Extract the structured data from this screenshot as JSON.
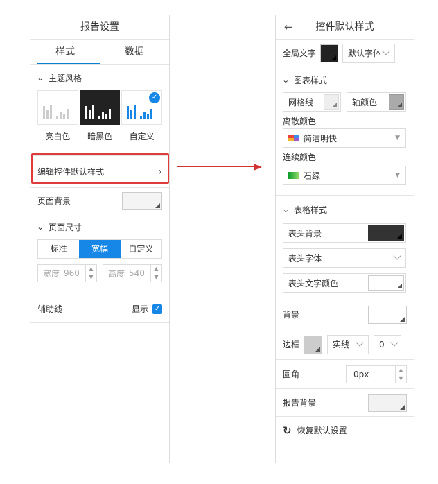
{
  "left": {
    "title": "报告设置",
    "tabs": [
      {
        "label": "样式"
      },
      {
        "label": "数据"
      }
    ],
    "theme_section": "主题风格",
    "themes": [
      {
        "label": "亮白色"
      },
      {
        "label": "暗黑色"
      },
      {
        "label": "自定义"
      }
    ],
    "edit_default": "编辑控件默认样式",
    "page_bg": "页面背景",
    "page_size_section": "页面尺寸",
    "size_options": [
      "标准",
      "宽幅",
      "自定义"
    ],
    "width_label": "宽度",
    "width_value": "960",
    "height_label": "高度",
    "height_value": "540",
    "guide": "辅助线",
    "guide_show": "显示"
  },
  "right": {
    "title": "控件默认样式",
    "back_icon": "←",
    "global_text": "全局文字",
    "global_font": "默认字体",
    "chart_section": "图表样式",
    "grid_line": "网格线",
    "axis_color": "轴颜色",
    "discrete_color": "离散颜色",
    "discrete_value": "简洁明快",
    "continuous_color": "连续颜色",
    "continuous_value": "石绿",
    "table_section": "表格样式",
    "header_bg": "表头背景",
    "header_font": "表头字体",
    "header_text_color": "表头文字颜色",
    "background": "背景",
    "border": "边框",
    "border_style": "实线",
    "border_width": "0",
    "radius": "圆角",
    "radius_value": "0px",
    "report_bg": "报告背景",
    "reset": "恢复默认设置"
  },
  "colors": {
    "accent": "#1687e6",
    "highlight": "#e03b3b",
    "arrow": "#d23434"
  }
}
